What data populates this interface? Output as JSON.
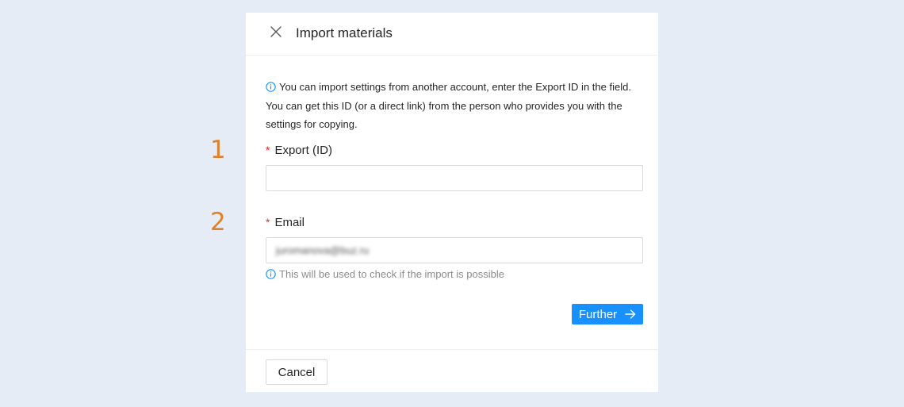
{
  "steps": {
    "first": "1",
    "second": "2"
  },
  "dialog": {
    "title": "Import materials",
    "close_icon": "close-icon",
    "info_icon": "info-circle-icon",
    "info_text": "You can import settings from another account, enter the Export ID in the field. You can get this ID (or a direct link) from the person who provides you with the settings for copying.",
    "export_field": {
      "required_mark": "*",
      "label": "Export (ID)",
      "value": ""
    },
    "email_field": {
      "required_mark": "*",
      "label": "Email",
      "value": "juromanova@buz.ru",
      "hint": "This will be used to check if the import is possible"
    },
    "further_button": {
      "label": "Further",
      "icon": "arrow-right-icon"
    },
    "cancel_button": {
      "label": "Cancel"
    }
  },
  "colors": {
    "accent": "#1890ff",
    "background": "#e5ecf6",
    "step_number": "#e0802a",
    "required": "#f5222d"
  }
}
